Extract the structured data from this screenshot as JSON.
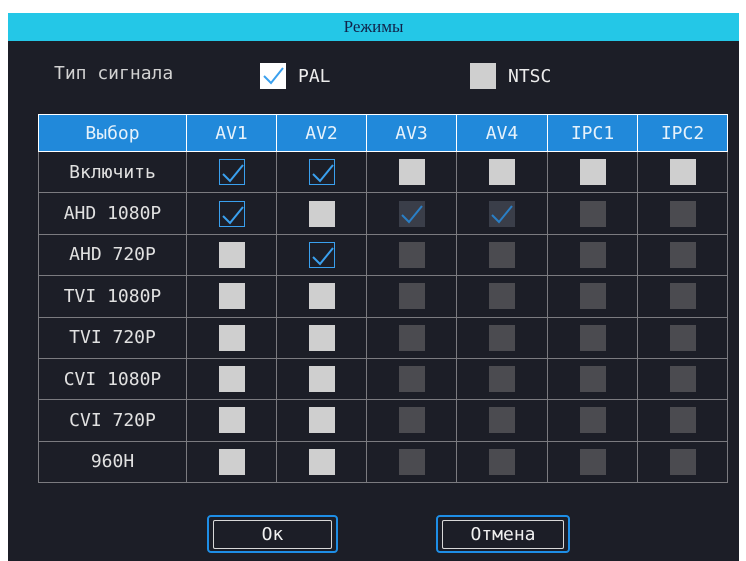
{
  "dialog": {
    "title": "Режимы"
  },
  "signal": {
    "label": "Тип сигнала",
    "options": [
      {
        "label": "PAL",
        "checked": true
      },
      {
        "label": "NTSC",
        "checked": false
      }
    ]
  },
  "table": {
    "header": [
      "Выбор",
      "AV1",
      "AV2",
      "AV3",
      "AV4",
      "IPC1",
      "IPC2"
    ],
    "rows": [
      {
        "label": "Включить",
        "cells": [
          "checked",
          "checked",
          "on",
          "on",
          "on",
          "on"
        ]
      },
      {
        "label": "AHD 1080P",
        "cells": [
          "checked",
          "on",
          "dimchecked",
          "dimchecked",
          "dim",
          "dim"
        ]
      },
      {
        "label": "AHD 720P",
        "cells": [
          "on",
          "checked",
          "dim",
          "dim",
          "dim",
          "dim"
        ]
      },
      {
        "label": "TVI 1080P",
        "cells": [
          "on",
          "on",
          "dim",
          "dim",
          "dim",
          "dim"
        ]
      },
      {
        "label": "TVI 720P",
        "cells": [
          "on",
          "on",
          "dim",
          "dim",
          "dim",
          "dim"
        ]
      },
      {
        "label": "CVI 1080P",
        "cells": [
          "on",
          "on",
          "dim",
          "dim",
          "dim",
          "dim"
        ]
      },
      {
        "label": "CVI 720P",
        "cells": [
          "on",
          "on",
          "dim",
          "dim",
          "dim",
          "dim"
        ]
      },
      {
        "label": "960H",
        "cells": [
          "on",
          "on",
          "dim",
          "dim",
          "dim",
          "dim"
        ]
      }
    ]
  },
  "buttons": {
    "ok": "Ок",
    "cancel": "Отмена"
  },
  "colors": {
    "title_bg": "#24c7e7",
    "header_bg": "#2189da",
    "panel_bg": "#1c1e27",
    "check": "#3aa0ee"
  }
}
